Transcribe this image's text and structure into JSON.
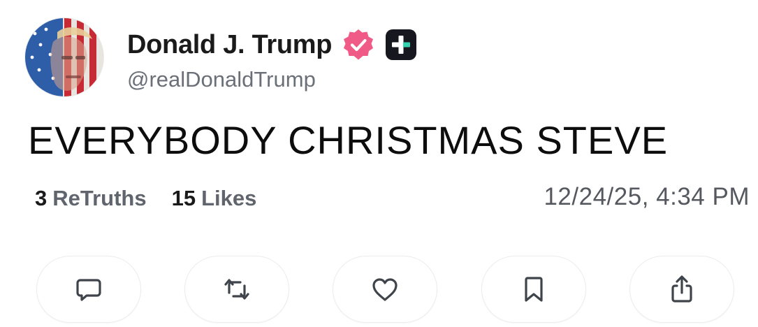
{
  "author": {
    "display_name": "Donald J. Trump",
    "handle": "@realDonaldTrump",
    "avatar_icon": "flag-portrait-avatar",
    "verified_icon": "verified-badge-icon",
    "plus_icon": "truth-social-plus-icon"
  },
  "post": {
    "text": "EVERYBODY CHRISTMAS STEVE",
    "timestamp": "12/24/25, 4:34 PM"
  },
  "stats": {
    "retruths_count": "3",
    "retruths_label": "ReTruths",
    "likes_count": "15",
    "likes_label": "Likes"
  },
  "actions": [
    {
      "icon": "comment-icon"
    },
    {
      "icon": "retruth-icon"
    },
    {
      "icon": "like-icon"
    },
    {
      "icon": "bookmark-icon"
    },
    {
      "icon": "share-icon"
    }
  ],
  "colors": {
    "verified_badge": "#ef5a86",
    "plus_badge": "#17181f",
    "icon_stroke": "#3f434a",
    "secondary_text": "#6b6f78"
  }
}
